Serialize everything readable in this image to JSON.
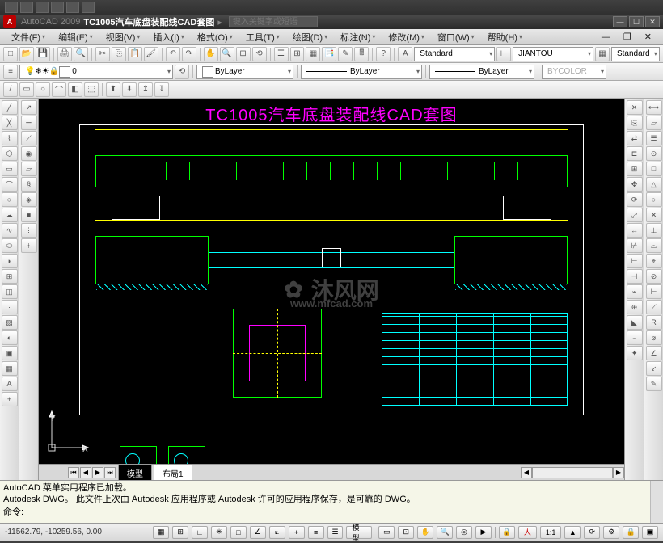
{
  "title": {
    "app": "AutoCAD 2009",
    "doc": "TC1005汽车底盘装配线CAD套图",
    "search_placeholder": "键入关键字或短语",
    "logo": "A"
  },
  "menu": {
    "file": "文件(F)",
    "edit": "编辑(E)",
    "view": "视图(V)",
    "insert": "插入(I)",
    "format": "格式(O)",
    "tools": "工具(T)",
    "draw": "绘图(D)",
    "dimension": "标注(N)",
    "modify": "修改(M)",
    "window": "窗口(W)",
    "help": "帮助(H)"
  },
  "props": {
    "layer": "0",
    "color": "ByLayer",
    "linetype": "ByLayer",
    "lineweight": "ByLayer",
    "plotstyle": "BYCOLOR",
    "textstyle": "Standard",
    "dimstyle": "JIANTOU",
    "tablestyle": "Standard"
  },
  "drawing": {
    "title": "TC1005汽车底盘装配线CAD套图"
  },
  "watermark": {
    "text": "沐风网",
    "url": "www.mfcad.com"
  },
  "tabs": {
    "model": "模型",
    "layout1": "布局1"
  },
  "ucs": {
    "x": "X",
    "y": "Y"
  },
  "cmd": {
    "line1": "AutoCAD 菜单实用程序已加载。",
    "line2": "Autodesk DWG。  此文件上次由 Autodesk 应用程序或 Autodesk 许可的应用程序保存，是可靠的 DWG。",
    "prompt": "命令:"
  },
  "status": {
    "coords": "-11562.79,  -10259.56,  0.00",
    "model_btn": "模型",
    "scale": "1:1",
    "anno": "人"
  }
}
